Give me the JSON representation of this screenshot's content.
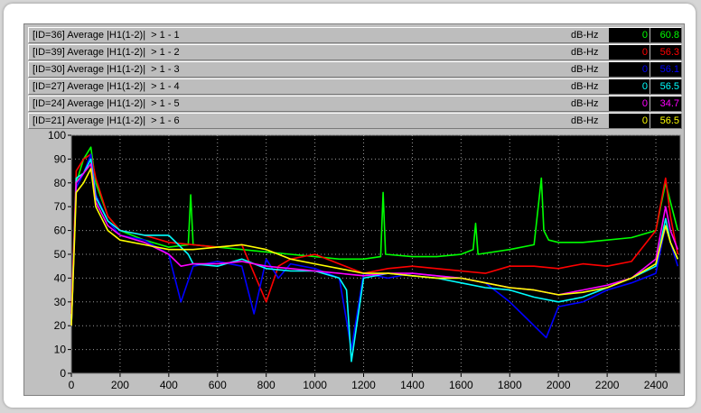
{
  "legend": [
    {
      "label": "[ID=36] Average |H1(1-2)|  > 1 - 1",
      "unit": "dB-Hz",
      "v1": "0",
      "v2": "60.8",
      "color": "#00ff00"
    },
    {
      "label": "[ID=39] Average |H1(1-2)|  > 1 - 2",
      "unit": "dB-Hz",
      "v1": "0",
      "v2": "56.3",
      "color": "#ff0000"
    },
    {
      "label": "[ID=30] Average |H1(1-2)|  > 1 - 3",
      "unit": "dB-Hz",
      "v1": "0",
      "v2": "56.1",
      "color": "#0000ff"
    },
    {
      "label": "[ID=27] Average |H1(1-2)|  > 1 - 4",
      "unit": "dB-Hz",
      "v1": "0",
      "v2": "56.5",
      "color": "#00ffff"
    },
    {
      "label": "[ID=24] Average |H1(1-2)|  > 1 - 5",
      "unit": "dB-Hz",
      "v1": "0",
      "v2": "34.7",
      "color": "#ff00ff"
    },
    {
      "label": "[ID=21] Average |H1(1-2)|  > 1 - 6",
      "unit": "dB-Hz",
      "v1": "0",
      "v2": "56.5",
      "color": "#ffff00"
    }
  ],
  "chart_data": {
    "type": "line",
    "title": "",
    "xlabel": "",
    "ylabel": "",
    "xlim": [
      0,
      2500
    ],
    "ylim": [
      0,
      100
    ],
    "xticks": [
      0,
      200,
      400,
      600,
      800,
      1000,
      1200,
      1400,
      1600,
      1800,
      2000,
      2200,
      2400
    ],
    "yticks": [
      0,
      10,
      20,
      30,
      40,
      50,
      60,
      70,
      80,
      90,
      100
    ],
    "grid": true,
    "background": "#000000",
    "series": [
      {
        "name": "[ID=36] Average |H1(1-2)|  > 1 - 1",
        "color": "#00ff00",
        "x": [
          0,
          20,
          50,
          80,
          100,
          150,
          200,
          300,
          400,
          480,
          490,
          500,
          600,
          700,
          800,
          900,
          1000,
          1100,
          1200,
          1270,
          1280,
          1290,
          1400,
          1500,
          1600,
          1650,
          1660,
          1670,
          1800,
          1900,
          1930,
          1940,
          1960,
          2000,
          2100,
          2200,
          2300,
          2400,
          2440,
          2460,
          2490
        ],
        "y": [
          20,
          80,
          90,
          95,
          80,
          66,
          60,
          56,
          53,
          54,
          75,
          54,
          53,
          52,
          51,
          50,
          49,
          48,
          48,
          49,
          76,
          50,
          49,
          49,
          50,
          52,
          63,
          50,
          52,
          54,
          82,
          60,
          56,
          55,
          55,
          56,
          57,
          60,
          80,
          72,
          60
        ]
      },
      {
        "name": "[ID=39] Average |H1(1-2)|  > 1 - 2",
        "color": "#ff0000",
        "x": [
          0,
          20,
          50,
          80,
          100,
          150,
          200,
          300,
          400,
          500,
          600,
          700,
          800,
          850,
          900,
          1000,
          1100,
          1200,
          1300,
          1400,
          1500,
          1600,
          1700,
          1800,
          1900,
          2000,
          2100,
          2200,
          2300,
          2400,
          2440,
          2460,
          2490
        ],
        "y": [
          25,
          85,
          90,
          92,
          82,
          66,
          60,
          58,
          55,
          54,
          53,
          54,
          30,
          45,
          48,
          50,
          46,
          42,
          44,
          45,
          44,
          43,
          42,
          45,
          45,
          44,
          46,
          45,
          47,
          60,
          82,
          66,
          50
        ]
      },
      {
        "name": "[ID=30] Average |H1(1-2)|  > 1 - 3",
        "color": "#0000ff",
        "x": [
          0,
          20,
          50,
          80,
          100,
          150,
          200,
          300,
          400,
          450,
          500,
          600,
          700,
          750,
          800,
          850,
          900,
          1000,
          1100,
          1150,
          1200,
          1300,
          1400,
          1500,
          1600,
          1700,
          1800,
          1850,
          1900,
          1950,
          2000,
          2100,
          2200,
          2300,
          2400,
          2440,
          2460,
          2490
        ],
        "y": [
          20,
          78,
          84,
          92,
          75,
          64,
          58,
          56,
          50,
          30,
          45,
          47,
          45,
          25,
          48,
          40,
          46,
          44,
          40,
          10,
          42,
          40,
          42,
          41,
          40,
          38,
          30,
          25,
          20,
          15,
          28,
          30,
          35,
          38,
          42,
          62,
          55,
          45
        ]
      },
      {
        "name": "[ID=27] Average |H1(1-2)|  > 1 - 4",
        "color": "#00ffff",
        "x": [
          0,
          20,
          50,
          80,
          100,
          150,
          200,
          300,
          400,
          480,
          500,
          600,
          700,
          800,
          900,
          1000,
          1100,
          1130,
          1150,
          1200,
          1300,
          1400,
          1500,
          1600,
          1700,
          1800,
          1900,
          2000,
          2100,
          2200,
          2300,
          2400,
          2440,
          2460,
          2490
        ],
        "y": [
          20,
          82,
          84,
          90,
          74,
          64,
          60,
          58,
          58,
          50,
          46,
          45,
          48,
          44,
          43,
          43,
          40,
          35,
          5,
          40,
          42,
          41,
          40,
          38,
          36,
          35,
          32,
          30,
          32,
          36,
          40,
          45,
          65,
          55,
          48
        ]
      },
      {
        "name": "[ID=24] Average |H1(1-2)|  > 1 - 5",
        "color": "#ff00ff",
        "x": [
          0,
          20,
          50,
          80,
          100,
          150,
          200,
          300,
          400,
          450,
          500,
          600,
          700,
          800,
          900,
          1000,
          1100,
          1200,
          1300,
          1400,
          1500,
          1600,
          1700,
          1800,
          1900,
          2000,
          2100,
          2200,
          2300,
          2400,
          2440,
          2460,
          2490
        ],
        "y": [
          20,
          80,
          84,
          88,
          72,
          62,
          58,
          55,
          50,
          45,
          46,
          46,
          47,
          45,
          44,
          43,
          42,
          41,
          42,
          42,
          41,
          40,
          38,
          36,
          35,
          33,
          35,
          37,
          40,
          48,
          70,
          60,
          52
        ]
      },
      {
        "name": "[ID=21] Average |H1(1-2)|  > 1 - 6",
        "color": "#ffff00",
        "x": [
          0,
          20,
          50,
          80,
          100,
          150,
          200,
          300,
          400,
          500,
          600,
          700,
          800,
          900,
          1000,
          1100,
          1200,
          1300,
          1400,
          1500,
          1600,
          1700,
          1800,
          1900,
          2000,
          2100,
          2200,
          2300,
          2400,
          2440,
          2460,
          2490
        ],
        "y": [
          20,
          76,
          80,
          86,
          70,
          60,
          56,
          54,
          52,
          52,
          53,
          54,
          52,
          48,
          46,
          44,
          42,
          42,
          41,
          40,
          40,
          38,
          36,
          35,
          33,
          34,
          36,
          40,
          46,
          62,
          55,
          48
        ]
      }
    ]
  }
}
